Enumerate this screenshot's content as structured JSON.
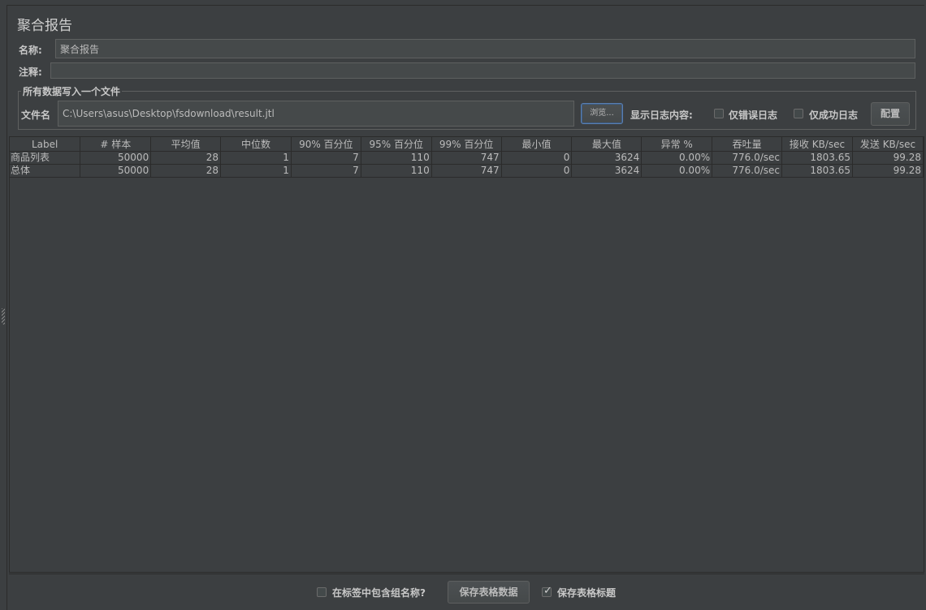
{
  "title": "聚合报告",
  "name_label": "名称:",
  "name_value": "聚合报告",
  "comment_label": "注释:",
  "comment_value": "",
  "file_group": {
    "title": "所有数据写入一个文件",
    "file_label": "文件名",
    "file_value": "C:\\Users\\asus\\Desktop\\fsdownload\\result.jtl",
    "browse_label": "浏览...",
    "log_label": "显示日志内容:",
    "errors_only_label": "仅错误日志",
    "success_only_label": "仅成功日志",
    "configure_label": "配置"
  },
  "table": {
    "headers": [
      "Label",
      "# 样本",
      "平均值",
      "中位数",
      "90% 百分位",
      "95% 百分位",
      "99% 百分位",
      "最小值",
      "最大值",
      "异常 %",
      "吞吐量",
      "接收 KB/sec",
      "发送 KB/sec"
    ],
    "rows": [
      [
        "商品列表",
        "50000",
        "28",
        "1",
        "7",
        "110",
        "747",
        "0",
        "3624",
        "0.00%",
        "776.0/sec",
        "1803.65",
        "99.28"
      ],
      [
        "总体",
        "50000",
        "28",
        "1",
        "7",
        "110",
        "747",
        "0",
        "3624",
        "0.00%",
        "776.0/sec",
        "1803.65",
        "99.28"
      ]
    ]
  },
  "bottom": {
    "include_group_label": "在标签中包含组名称?",
    "save_table_label": "保存表格数据",
    "save_header_label": "保存表格标题",
    "save_header_checked": true
  }
}
